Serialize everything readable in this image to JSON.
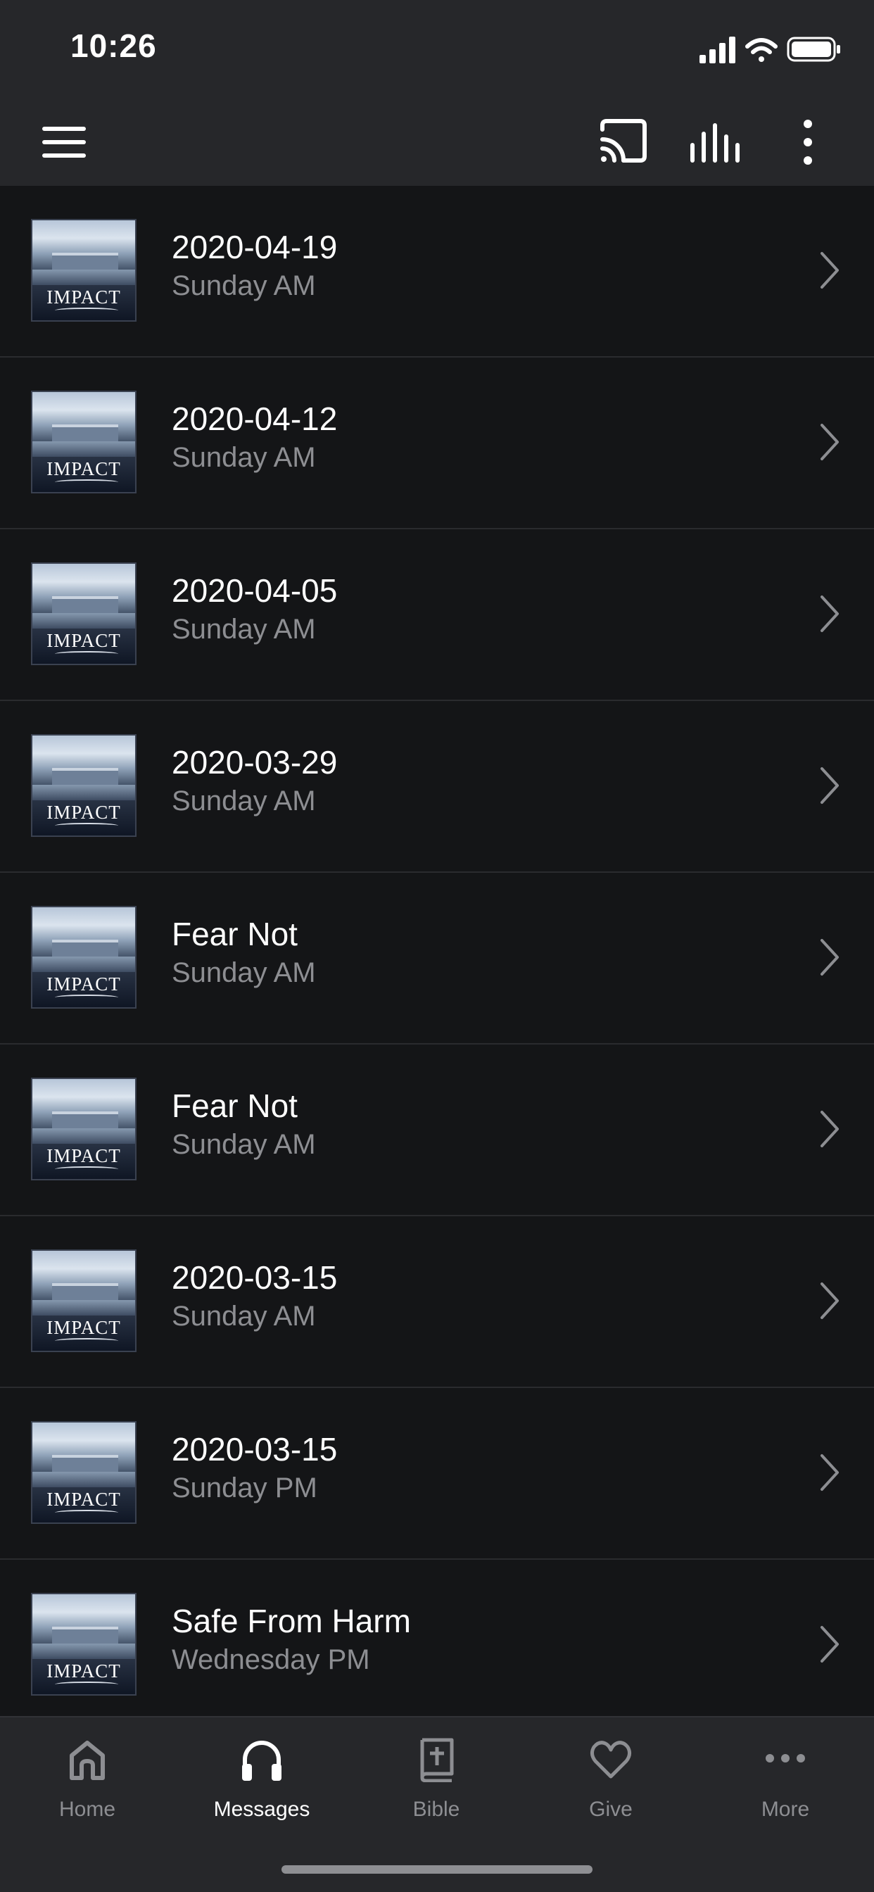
{
  "status": {
    "time": "10:26"
  },
  "header": {
    "menu_icon": "hamburger-menu-icon",
    "actions": [
      "cast-icon",
      "audio-bars-icon",
      "more-vertical-icon"
    ]
  },
  "messages": [
    {
      "title": "2020-04-19",
      "subtitle": "Sunday AM",
      "thumbnail_text": "IMPACT"
    },
    {
      "title": "2020-04-12",
      "subtitle": "Sunday AM",
      "thumbnail_text": "IMPACT"
    },
    {
      "title": "2020-04-05",
      "subtitle": "Sunday AM",
      "thumbnail_text": "IMPACT"
    },
    {
      "title": "2020-03-29",
      "subtitle": "Sunday AM",
      "thumbnail_text": "IMPACT"
    },
    {
      "title": "Fear Not",
      "subtitle": "Sunday AM",
      "thumbnail_text": "IMPACT"
    },
    {
      "title": "Fear Not",
      "subtitle": "Sunday AM",
      "thumbnail_text": "IMPACT"
    },
    {
      "title": "2020-03-15",
      "subtitle": "Sunday AM",
      "thumbnail_text": "IMPACT"
    },
    {
      "title": "2020-03-15",
      "subtitle": "Sunday PM",
      "thumbnail_text": "IMPACT"
    },
    {
      "title": "Safe From Harm",
      "subtitle": "Wednesday PM",
      "thumbnail_text": "IMPACT"
    }
  ],
  "tabs": [
    {
      "label": "Home",
      "icon": "home-icon",
      "active": false
    },
    {
      "label": "Messages",
      "icon": "headphones-icon",
      "active": true
    },
    {
      "label": "Bible",
      "icon": "bible-icon",
      "active": false
    },
    {
      "label": "Give",
      "icon": "heart-icon",
      "active": false
    },
    {
      "label": "More",
      "icon": "more-horizontal-icon",
      "active": false
    }
  ],
  "colors": {
    "background": "#141517",
    "bar": "#26272a",
    "text_primary": "#ffffff",
    "text_secondary": "#8d8e92",
    "divider": "#2a2b2e"
  }
}
